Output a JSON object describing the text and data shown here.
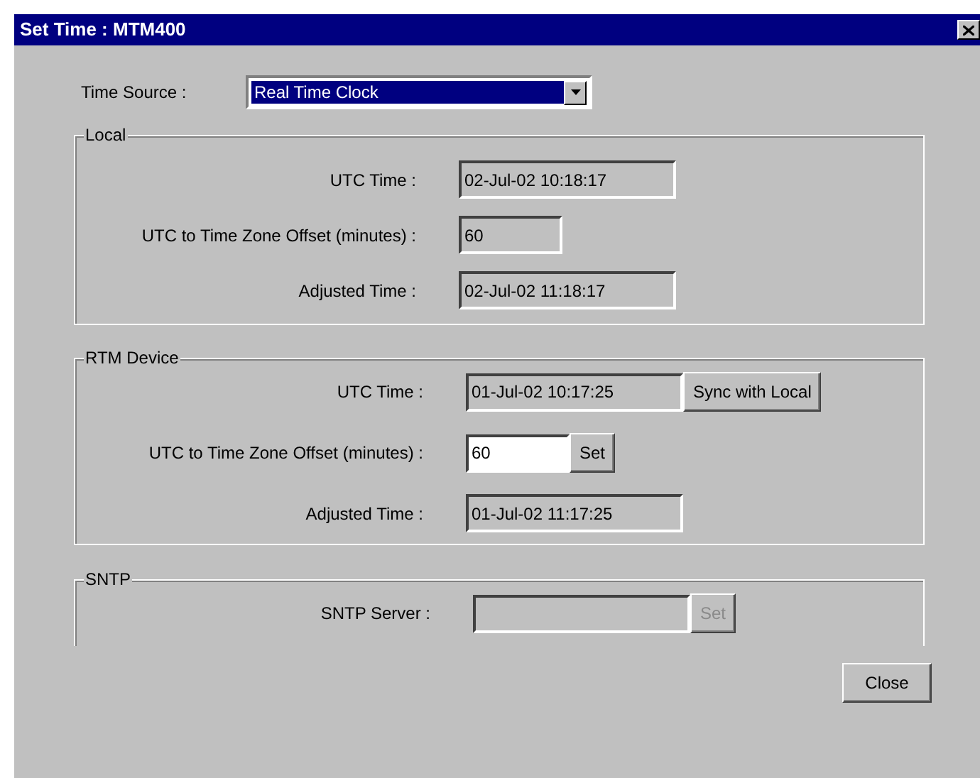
{
  "window": {
    "title": "Set Time : MTM400"
  },
  "time_source": {
    "label": "Time Source :",
    "value": "Real Time Clock",
    "focused": true
  },
  "groups": [
    {
      "title": "Local",
      "rows": [
        {
          "kind": "time",
          "label": "UTC Time :",
          "value": "02-Jul-02 10:18:17",
          "editable": false
        },
        {
          "kind": "offset",
          "label": "UTC to Time Zone Offset (minutes) :",
          "value": "60",
          "editable": false
        },
        {
          "kind": "time",
          "label": "Adjusted Time :",
          "value": "02-Jul-02 11:18:17",
          "editable": false
        }
      ]
    },
    {
      "title": "RTM Device",
      "rows": [
        {
          "kind": "time",
          "label": "UTC Time :",
          "value": "01-Jul-02 10:17:25",
          "editable": false,
          "button": {
            "label": "Sync with Local",
            "disabled": false
          }
        },
        {
          "kind": "offset",
          "label": "UTC to Time Zone Offset (minutes) :",
          "value": "60",
          "editable": true,
          "button": {
            "label": "Set",
            "disabled": false
          }
        },
        {
          "kind": "time",
          "label": "Adjusted Time :",
          "value": "01-Jul-02 11:17:25",
          "editable": false
        }
      ]
    },
    {
      "title": "SNTP",
      "rows": [
        {
          "kind": "time",
          "label": "SNTP Server :",
          "editable": false,
          "button": {
            "label": "Set",
            "disabled": true
          }
        }
      ]
    }
  ],
  "buttons": [
    {
      "label": "Close",
      "disabled": false
    }
  ]
}
